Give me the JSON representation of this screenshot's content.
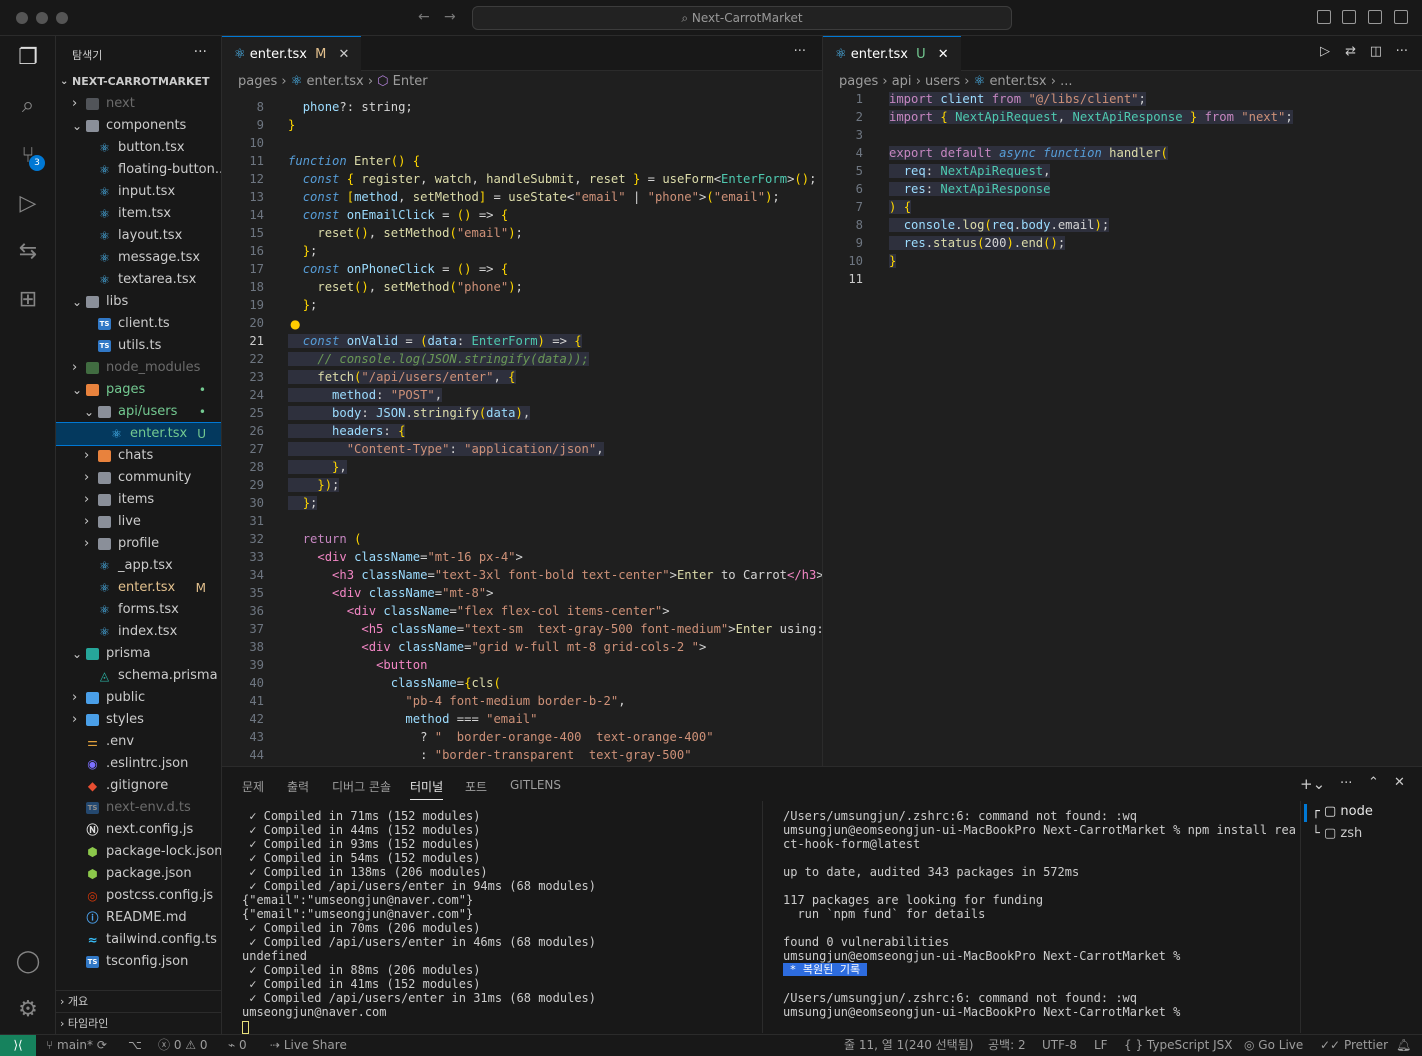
{
  "window": {
    "title": "Next-CarrotMarket"
  },
  "sidebar": {
    "title": "탐색기",
    "root": "NEXT-CARROTMARKET",
    "items": [
      {
        "label": "next",
        "kind": "folder",
        "depth": 1,
        "open": false,
        "dim": true
      },
      {
        "label": "components",
        "kind": "folder",
        "depth": 1,
        "open": true
      },
      {
        "label": "button.tsx",
        "kind": "react",
        "depth": 2
      },
      {
        "label": "floating-button...",
        "kind": "react",
        "depth": 2
      },
      {
        "label": "input.tsx",
        "kind": "react",
        "depth": 2
      },
      {
        "label": "item.tsx",
        "kind": "react",
        "depth": 2
      },
      {
        "label": "layout.tsx",
        "kind": "react",
        "depth": 2
      },
      {
        "label": "message.tsx",
        "kind": "react",
        "depth": 2
      },
      {
        "label": "textarea.tsx",
        "kind": "react",
        "depth": 2
      },
      {
        "label": "libs",
        "kind": "folder",
        "depth": 1,
        "open": true
      },
      {
        "label": "client.ts",
        "kind": "ts",
        "depth": 2
      },
      {
        "label": "utils.ts",
        "kind": "ts",
        "depth": 2
      },
      {
        "label": "node_modules",
        "kind": "folder-green",
        "depth": 1,
        "open": false,
        "dim": true
      },
      {
        "label": "pages",
        "kind": "folder-orange",
        "depth": 1,
        "open": true,
        "dot": "•"
      },
      {
        "label": "api/users",
        "kind": "folder",
        "depth": 2,
        "open": true,
        "dot": "•"
      },
      {
        "label": "enter.tsx",
        "kind": "react",
        "depth": 3,
        "status": "U",
        "selected": true
      },
      {
        "label": "chats",
        "kind": "folder-orange",
        "depth": 2,
        "open": false
      },
      {
        "label": "community",
        "kind": "folder",
        "depth": 2,
        "open": false
      },
      {
        "label": "items",
        "kind": "folder",
        "depth": 2,
        "open": false
      },
      {
        "label": "live",
        "kind": "folder",
        "depth": 2,
        "open": false
      },
      {
        "label": "profile",
        "kind": "folder",
        "depth": 2,
        "open": false
      },
      {
        "label": "_app.tsx",
        "kind": "react",
        "depth": 2
      },
      {
        "label": "enter.tsx",
        "kind": "react",
        "depth": 2,
        "status": "M"
      },
      {
        "label": "forms.tsx",
        "kind": "react",
        "depth": 2
      },
      {
        "label": "index.tsx",
        "kind": "react",
        "depth": 2
      },
      {
        "label": "prisma",
        "kind": "folder-teal",
        "depth": 1,
        "open": true
      },
      {
        "label": "schema.prisma",
        "kind": "prisma",
        "depth": 2
      },
      {
        "label": "public",
        "kind": "folder-blue",
        "depth": 1,
        "open": false
      },
      {
        "label": "styles",
        "kind": "folder-blue",
        "depth": 1,
        "open": false
      },
      {
        "label": ".env",
        "kind": "env",
        "depth": 1
      },
      {
        "label": ".eslintrc.json",
        "kind": "eslint",
        "depth": 1
      },
      {
        "label": ".gitignore",
        "kind": "git",
        "depth": 1
      },
      {
        "label": "next-env.d.ts",
        "kind": "ts",
        "depth": 1,
        "dim": true
      },
      {
        "label": "next.config.js",
        "kind": "next",
        "depth": 1
      },
      {
        "label": "package-lock.json",
        "kind": "node",
        "depth": 1
      },
      {
        "label": "package.json",
        "kind": "node",
        "depth": 1
      },
      {
        "label": "postcss.config.js",
        "kind": "postcss",
        "depth": 1
      },
      {
        "label": "README.md",
        "kind": "info",
        "depth": 1
      },
      {
        "label": "tailwind.config.ts",
        "kind": "tailwind",
        "depth": 1
      },
      {
        "label": "tsconfig.json",
        "kind": "ts",
        "depth": 1
      }
    ],
    "outline_label": "개요",
    "timeline_label": "타임라인"
  },
  "editor_left": {
    "tab": {
      "label": "enter.tsx",
      "status": "M"
    },
    "breadcrumbs": [
      "pages",
      "enter.tsx",
      "Enter"
    ],
    "lines": [
      {
        "n": "8",
        "t": "  phone?: string;"
      },
      {
        "n": "9",
        "t": "}"
      },
      {
        "n": "10",
        "t": ""
      },
      {
        "n": "11",
        "t": "function Enter() {"
      },
      {
        "n": "12",
        "t": "  const { register, watch, handleSubmit, reset } = useForm<EnterForm>();"
      },
      {
        "n": "13",
        "t": "  const [method, setMethod] = useState<\"email\" | \"phone\">(\"email\");"
      },
      {
        "n": "14",
        "t": "  const onEmailClick = () => {"
      },
      {
        "n": "15",
        "t": "    reset(), setMethod(\"email\");"
      },
      {
        "n": "16",
        "t": "  };"
      },
      {
        "n": "17",
        "t": "  const onPhoneClick = () => {"
      },
      {
        "n": "18",
        "t": "    reset(), setMethod(\"phone\");"
      },
      {
        "n": "19",
        "t": "  };"
      },
      {
        "n": "20",
        "t": ""
      },
      {
        "n": "21",
        "t": "  const onValid = (data: EnterForm) => {"
      },
      {
        "n": "22",
        "t": "    // console.log(JSON.stringify(data));"
      },
      {
        "n": "23",
        "t": "    fetch(\"/api/users/enter\", {"
      },
      {
        "n": "24",
        "t": "      method: \"POST\","
      },
      {
        "n": "25",
        "t": "      body: JSON.stringify(data),"
      },
      {
        "n": "26",
        "t": "      headers: {"
      },
      {
        "n": "27",
        "t": "        \"Content-Type\": \"application/json\","
      },
      {
        "n": "28",
        "t": "      },"
      },
      {
        "n": "29",
        "t": "    });"
      },
      {
        "n": "30",
        "t": "  };"
      },
      {
        "n": "31",
        "t": ""
      },
      {
        "n": "32",
        "t": "  return ("
      },
      {
        "n": "33",
        "t": "    <div className=\"mt-16 px-4\">"
      },
      {
        "n": "34",
        "t": "      <h3 className=\"text-3xl font-bold text-center\">Enter to Carrot</h3>"
      },
      {
        "n": "35",
        "t": "      <div className=\"mt-8\">"
      },
      {
        "n": "36",
        "t": "        <div className=\"flex flex-col items-center\">"
      },
      {
        "n": "37",
        "t": "          <h5 className=\"text-sm  text-gray-500 font-medium\">Enter using:"
      },
      {
        "n": "38",
        "t": "          <div className=\"grid w-full mt-8 grid-cols-2 \">"
      },
      {
        "n": "39",
        "t": "            <button"
      },
      {
        "n": "40",
        "t": "              className={cls("
      },
      {
        "n": "41",
        "t": "                \"pb-4 font-medium border-b-2\","
      },
      {
        "n": "42",
        "t": "                method === \"email\""
      },
      {
        "n": "43",
        "t": "                  ? \"  border-orange-400  text-orange-400\""
      },
      {
        "n": "44",
        "t": "                  : \"border-transparent  text-gray-500\""
      }
    ]
  },
  "editor_right": {
    "tab": {
      "label": "enter.tsx",
      "status": "U"
    },
    "breadcrumbs": [
      "pages",
      "api",
      "users",
      "enter.tsx",
      "..."
    ],
    "lines": [
      {
        "n": "1",
        "t": "import client from \"@/libs/client\";"
      },
      {
        "n": "2",
        "t": "import { NextApiRequest, NextApiResponse } from \"next\";"
      },
      {
        "n": "3",
        "t": ""
      },
      {
        "n": "4",
        "t": "export default async function handler("
      },
      {
        "n": "5",
        "t": "  req: NextApiRequest,"
      },
      {
        "n": "6",
        "t": "  res: NextApiResponse"
      },
      {
        "n": "7",
        "t": ") {"
      },
      {
        "n": "8",
        "t": "  console.log(req.body.email);"
      },
      {
        "n": "9",
        "t": "  res.status(200).end();"
      },
      {
        "n": "10",
        "t": "}"
      },
      {
        "n": "11",
        "t": ""
      }
    ]
  },
  "panel": {
    "tabs": [
      "문제",
      "출력",
      "디버그 콘솔",
      "터미널",
      "포트",
      "GITLENS"
    ],
    "active_tab": "터미널",
    "terminal_left": [
      " ✓ Compiled in 71ms (152 modules)",
      " ✓ Compiled in 44ms (152 modules)",
      " ✓ Compiled in 93ms (152 modules)",
      " ✓ Compiled in 54ms (152 modules)",
      " ✓ Compiled in 138ms (206 modules)",
      " ✓ Compiled /api/users/enter in 94ms (68 modules)",
      "{\"email\":\"umseongjun@naver.com\"}",
      "{\"email\":\"umseongjun@naver.com\"}",
      " ✓ Compiled in 70ms (206 modules)",
      " ✓ Compiled /api/users/enter in 46ms (68 modules)",
      "undefined",
      " ✓ Compiled in 88ms (206 modules)",
      " ✓ Compiled in 41ms (152 modules)",
      " ✓ Compiled /api/users/enter in 31ms (68 modules)",
      "umseongjun@naver.com"
    ],
    "terminal_right": [
      "/Users/umsungjun/.zshrc:6: command not found: :wq",
      "umsungjun@eomseongjun-ui-MacBookPro Next-CarrotMarket % npm install rea",
      "ct-hook-form@latest",
      "",
      "up to date, audited 343 packages in 572ms",
      "",
      "117 packages are looking for funding",
      "  run `npm fund` for details",
      "",
      "found 0 vulnerabilities",
      "umsungjun@eomseongjun-ui-MacBookPro Next-CarrotMarket %",
      "",
      "",
      "/Users/umsungjun/.zshrc:6: command not found: :wq",
      "umsungjun@eomseongjun-ui-MacBookPro Next-CarrotMarket %"
    ],
    "restored_label": " * 복원된 기록 ",
    "terminals": [
      "node",
      "zsh"
    ]
  },
  "status": {
    "branch": "main*",
    "errors": "0",
    "warnings": "0",
    "ports": "0",
    "live_share": "Live Share",
    "position": "줄 11, 열 1(240 선택됨)",
    "spaces": "공백: 2",
    "encoding": "UTF-8",
    "eol": "LF",
    "language": "TypeScript JSX",
    "golive": "Go Live",
    "prettier": "Prettier"
  },
  "colors": {
    "accent": "#0078d4",
    "remote": "#16825d",
    "bg": "#1f1f1f"
  }
}
